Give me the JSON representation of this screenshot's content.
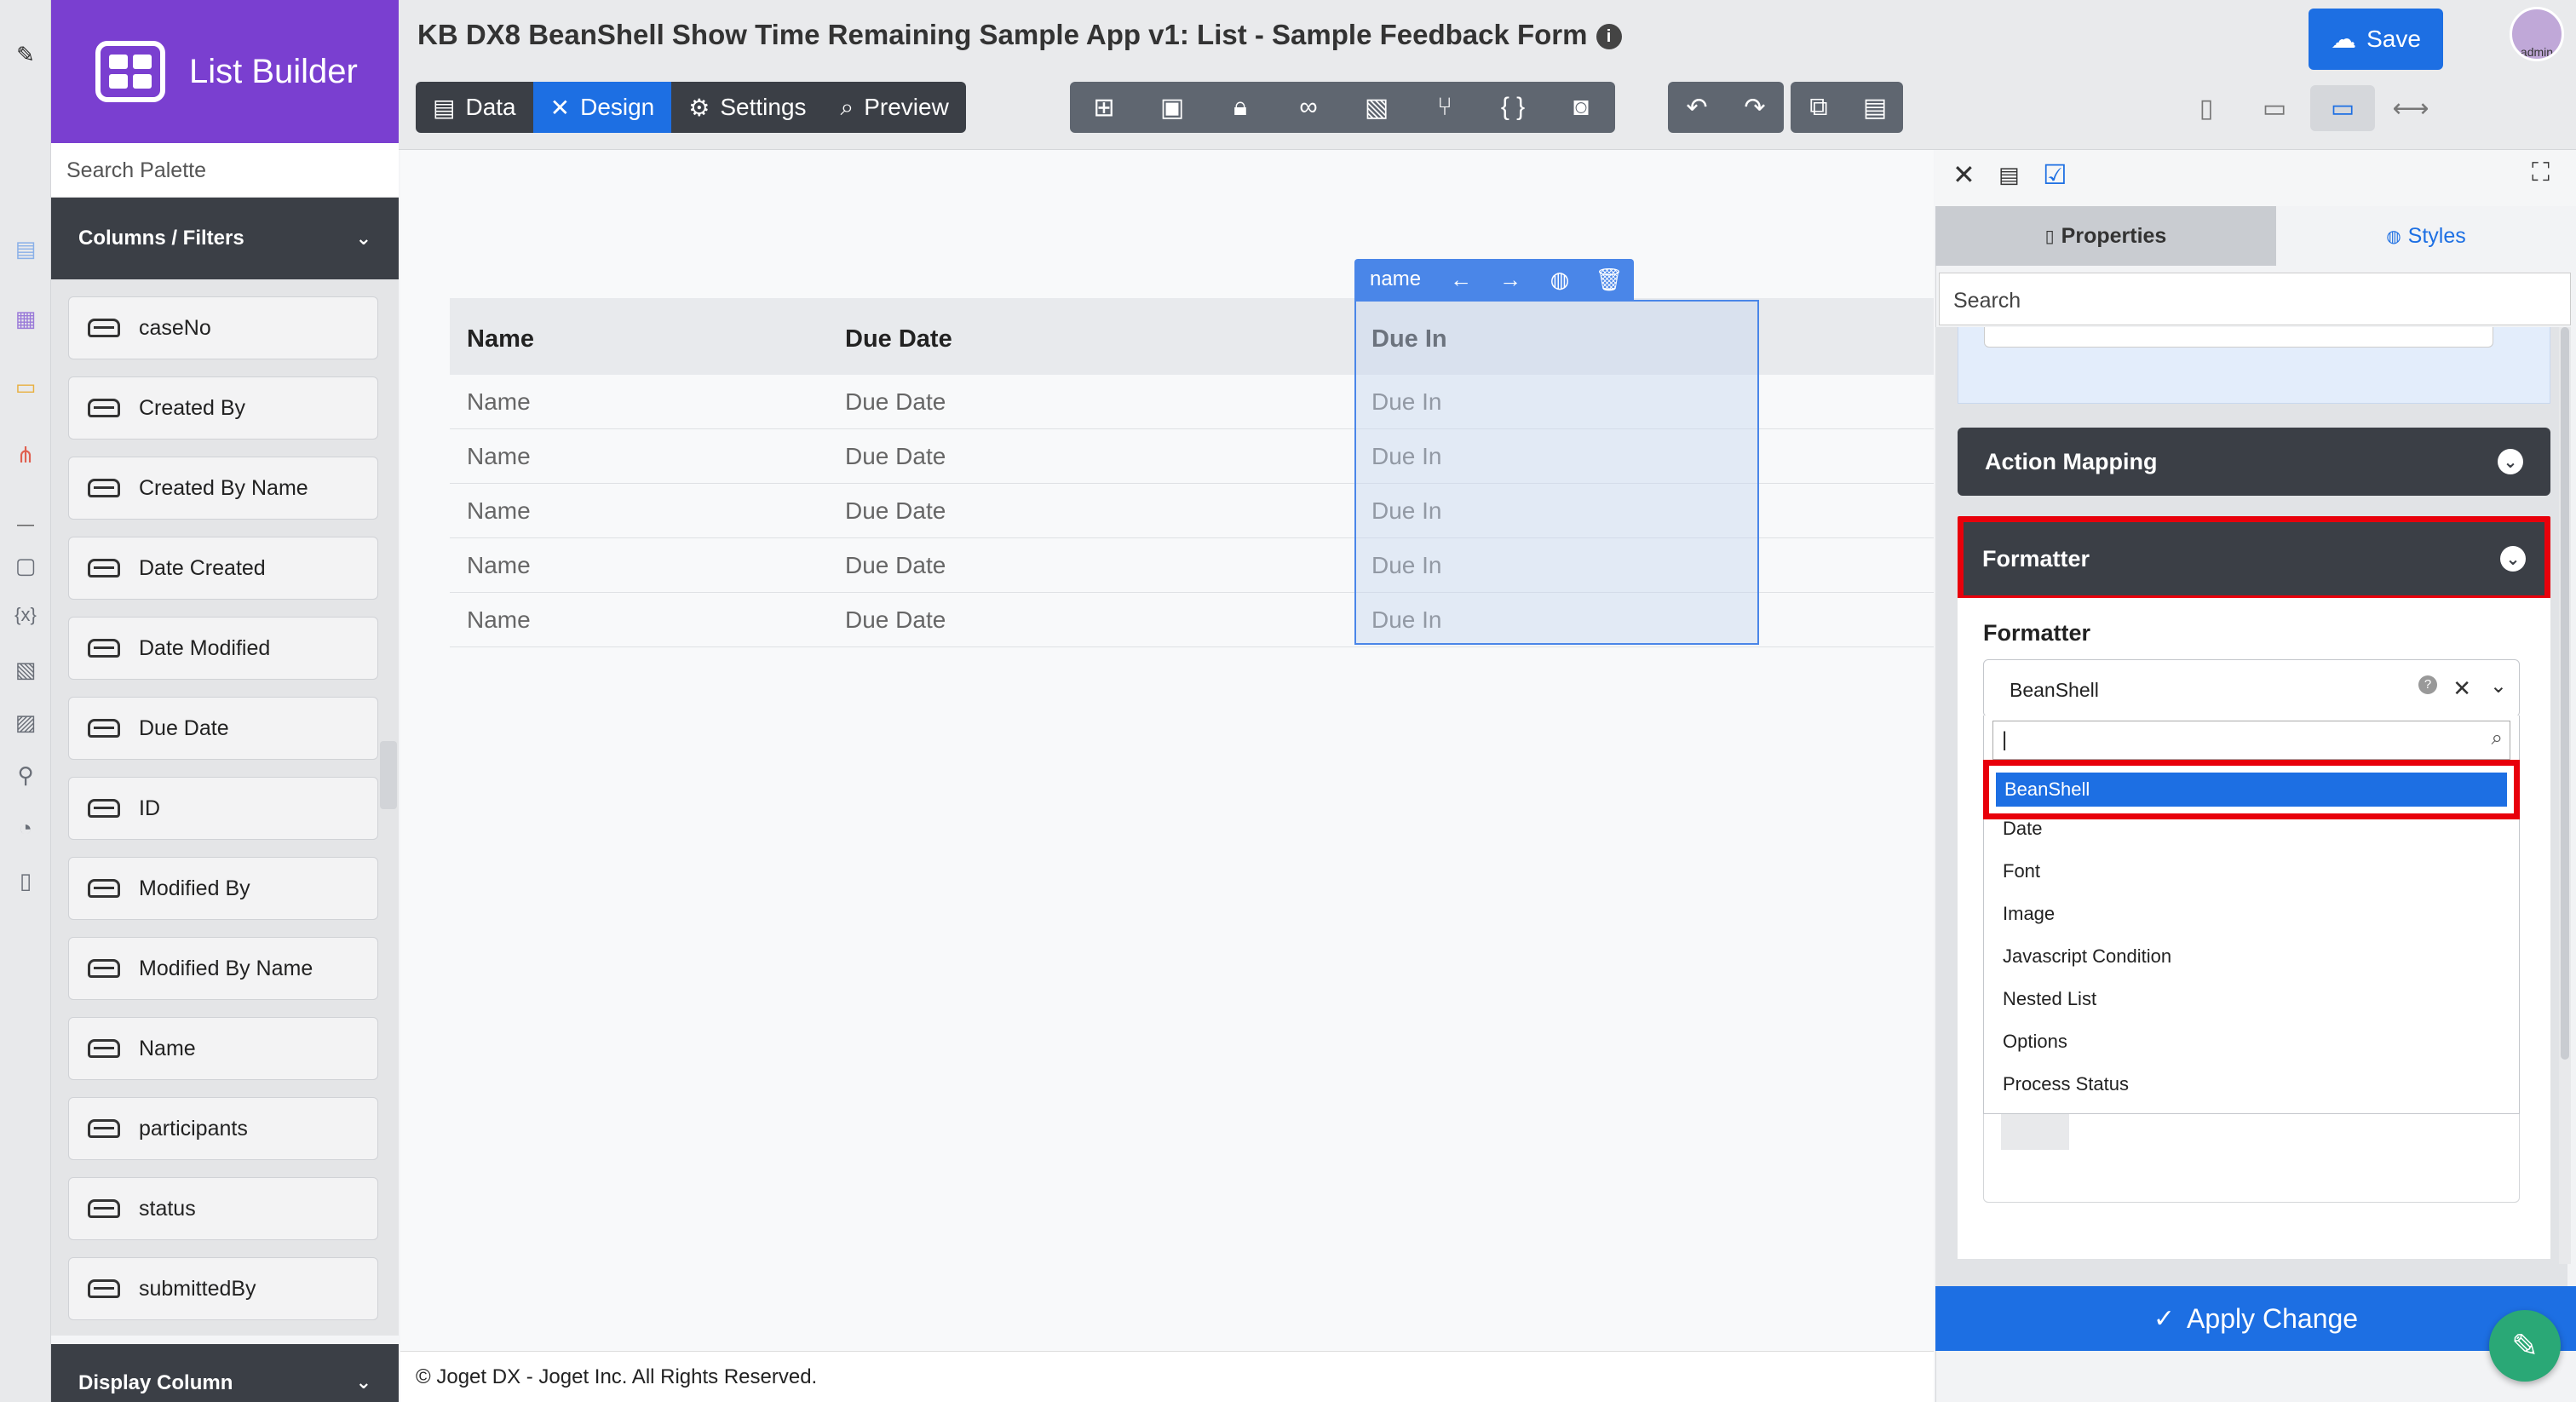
{
  "app": {
    "logo_label": "List Builder",
    "title": "KB DX8 BeanShell Show Time Remaining Sample App v1: List - Sample Feedback Form",
    "info_icon": "info-icon",
    "save_label": "Save",
    "avatar_label": "admin"
  },
  "rail": {
    "icons": [
      "edit-icon",
      "document-icon",
      "list-icon",
      "desktop-icon",
      "flow-icon",
      "note-icon",
      "variable-icon",
      "image-icon",
      "report-icon",
      "plugin-icon",
      "dashboard-icon",
      "scroll-icon"
    ]
  },
  "modes": [
    {
      "label": "Data",
      "icon": "table-icon"
    },
    {
      "label": "Design",
      "icon": "tools-icon",
      "active": true
    },
    {
      "label": "Settings",
      "icon": "gear-icon"
    },
    {
      "label": "Preview",
      "icon": "preview-icon"
    }
  ],
  "toolbar": {
    "tools": [
      "sitemap-icon",
      "outline-icon",
      "lock-icon",
      "binoculars-icon",
      "translate-icon",
      "branch-icon",
      "code-icon",
      "camera-icon"
    ],
    "history": [
      "undo-icon",
      "redo-icon"
    ],
    "clipboard": [
      "copy-icon",
      "paste-icon"
    ],
    "devices": [
      "phone-icon",
      "tablet-icon",
      "laptop-icon",
      "expand-icon"
    ]
  },
  "palette": {
    "search_placeholder": "Search Palette",
    "section_title": "Columns / Filters",
    "items": [
      "caseNo",
      "Created By",
      "Created By Name",
      "Date Created",
      "Date Modified",
      "Due Date",
      "ID",
      "Modified By",
      "Modified By Name",
      "Name",
      "participants",
      "status",
      "submittedBy"
    ],
    "footer_section": "Display Column"
  },
  "table": {
    "headers": [
      "Name",
      "Due Date",
      "Due In"
    ],
    "rows": [
      [
        "Name",
        "Due Date",
        "Due In"
      ],
      [
        "Name",
        "Due Date",
        "Due In"
      ],
      [
        "Name",
        "Due Date",
        "Due In"
      ],
      [
        "Name",
        "Due Date",
        "Due In"
      ],
      [
        "Name",
        "Due Date",
        "Due In"
      ]
    ],
    "selected_column_label": "name"
  },
  "footer": {
    "text": "© Joget DX - Joget Inc. All Rights Reserved."
  },
  "properties": {
    "tabs": {
      "properties": "Properties",
      "styles": "Styles"
    },
    "search_placeholder": "Search",
    "action_mapping": "Action Mapping",
    "formatter_section": "Formatter",
    "formatter_label": "Formatter",
    "formatter_value": "BeanShell",
    "options": [
      "BeanShell",
      "Date",
      "Font",
      "Image",
      "Javascript Condition",
      "Nested List",
      "Options",
      "Process Status"
    ],
    "apply_label": "Apply Change"
  },
  "colors": {
    "accent": "#1d6fe3",
    "brand": "#7a3fd0",
    "highlight": "#e8000b",
    "dark": "#3b3f46"
  }
}
